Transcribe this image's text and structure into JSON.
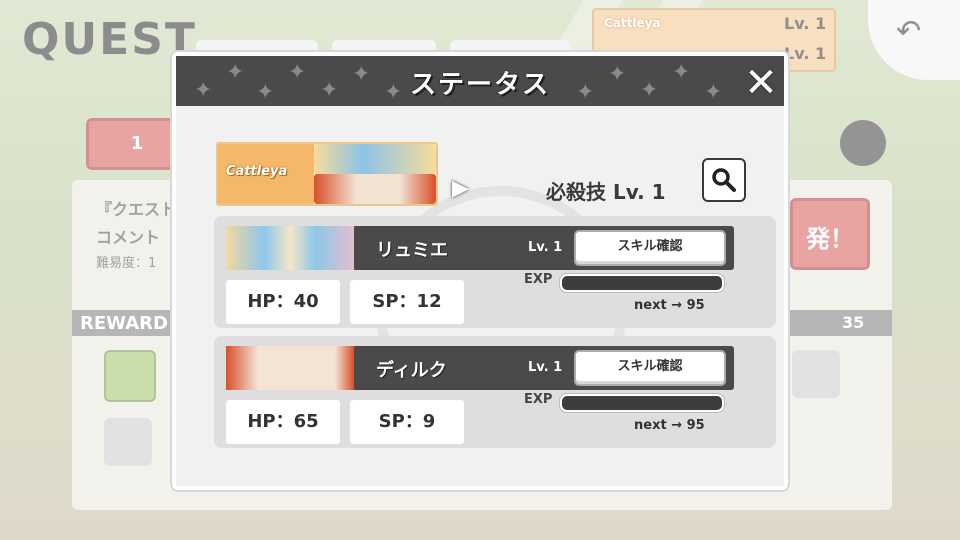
{
  "background": {
    "title": "QUEST",
    "team_card_name": "Cattleya",
    "lv1": "Lv. 1",
    "lv2": "Lv. 1",
    "counter": "1",
    "quest_text": "『クエスト",
    "comment_text": "コメント",
    "difficulty": "難易度：1",
    "reward_label": "REWARD",
    "reward_count": "35",
    "start_button": "発！"
  },
  "modal": {
    "title": "ステータス",
    "team": {
      "name": "Cattleya"
    },
    "special": {
      "label": "必殺技",
      "level": "Lv. 1"
    },
    "characters": [
      {
        "name": "リュミエ",
        "level": "Lv. 1",
        "skill_button": "スキル確認",
        "hp": "HP：40",
        "sp": "SP：12",
        "exp_label": "EXP",
        "exp_fraction": 0,
        "next": "next → 95"
      },
      {
        "name": "ディルク",
        "level": "Lv. 1",
        "skill_button": "スキル確認",
        "hp": "HP：65",
        "sp": "SP：9",
        "exp_label": "EXP",
        "exp_fraction": 0,
        "next": "next → 95"
      }
    ]
  },
  "colors": {
    "header": "#4a4a4a",
    "accent_red": "#d85a55",
    "team_orange": "#f5b86a"
  }
}
